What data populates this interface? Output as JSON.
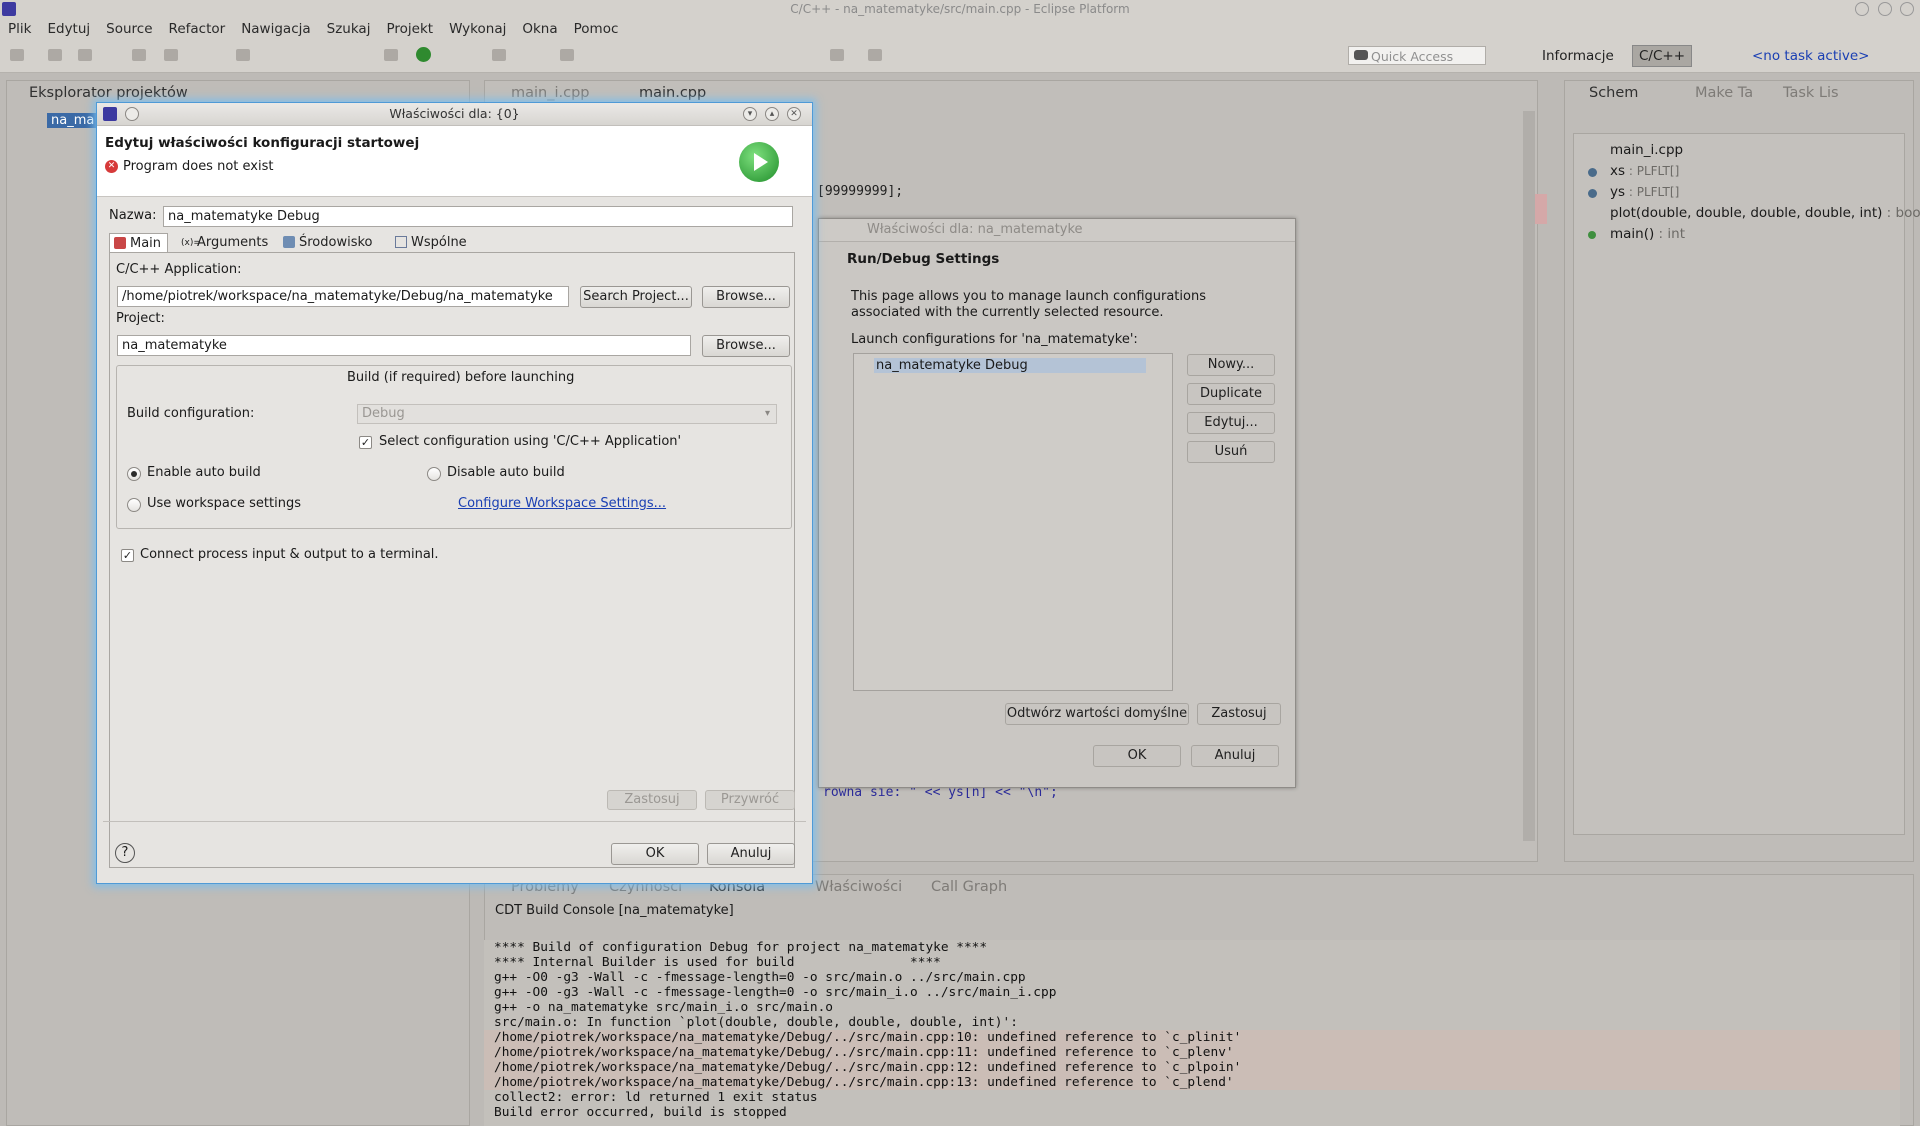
{
  "window": {
    "title": "C/C++ - na_matematyke/src/main.cpp - Eclipse Platform"
  },
  "menu": [
    "Plik",
    "Edytuj",
    "Source",
    "Refactor",
    "Nawigacja",
    "Szukaj",
    "Projekt",
    "Wykonaj",
    "Okna",
    "Pomoc"
  ],
  "toolbar": {
    "quick_access_placeholder": "Quick Access",
    "perspective_info": "Informacje",
    "perspective_cpp": "C/C++",
    "task": "<no task active>"
  },
  "left_pane": {
    "tab": "Eksplorator projektów",
    "item": "na_ma"
  },
  "editor": {
    "tabs": [
      "main_i.cpp",
      "main.cpp"
    ],
    "lines": [
      {
        "text": "[99999999];"
      },
      {
        "text": "rowna sie: \" << ys[n] << \"\\n\";"
      }
    ]
  },
  "outline": {
    "tabs": [
      "Schem",
      "Make Ta",
      "Task Lis"
    ],
    "items": [
      {
        "name": "main_i.cpp",
        "type": ""
      },
      {
        "name": "xs",
        "type": " : PLFLT[]"
      },
      {
        "name": "ys",
        "type": " : PLFLT[]"
      },
      {
        "name": "plot(double, double, double, double, int)",
        "type": " : bool"
      },
      {
        "name": "main()",
        "type": " : int"
      }
    ]
  },
  "bottom": {
    "tabs": [
      "Problemy",
      "Czynności",
      "Konsola",
      "Właściwości",
      "Call Graph"
    ],
    "console_title": "CDT Build Console [na_matematyke]",
    "lines": [
      {
        "text": "",
        "err": false
      },
      {
        "text": "**** Build of configuration Debug for project na_matematyke ****",
        "err": false
      },
      {
        "text": "",
        "err": false
      },
      {
        "text": "**** Internal Builder is used for build               ****",
        "err": false
      },
      {
        "text": "g++ -O0 -g3 -Wall -c -fmessage-length=0 -o src/main.o ../src/main.cpp",
        "err": false
      },
      {
        "text": "g++ -O0 -g3 -Wall -c -fmessage-length=0 -o src/main_i.o ../src/main_i.cpp",
        "err": false
      },
      {
        "text": "g++ -o na_matematyke src/main_i.o src/main.o",
        "err": false
      },
      {
        "text": "src/main.o: In function `plot(double, double, double, double, int)':",
        "err": false
      },
      {
        "text": "/home/piotrek/workspace/na_matematyke/Debug/../src/main.cpp:10: undefined reference to `c_plinit'",
        "err": true
      },
      {
        "text": "/home/piotrek/workspace/na_matematyke/Debug/../src/main.cpp:11: undefined reference to `c_plenv'",
        "err": true
      },
      {
        "text": "/home/piotrek/workspace/na_matematyke/Debug/../src/main.cpp:12: undefined reference to `c_plpoin'",
        "err": true
      },
      {
        "text": "/home/piotrek/workspace/na_matematyke/Debug/../src/main.cpp:13: undefined reference to `c_plend'",
        "err": true
      },
      {
        "text": "collect2: error: ld returned 1 exit status",
        "err": false
      },
      {
        "text": "Build error occurred, build is stopped",
        "err": false
      }
    ]
  },
  "dialog2": {
    "title": "Właściwości dla: na_matematyke",
    "heading": "Run/Debug Settings",
    "description": "This page allows you to manage launch configurations associated with the currently selected resource.",
    "list_label": "Launch configurations for 'na_matematyke':",
    "items": [
      "na_matematyke Debug"
    ],
    "buttons": {
      "new": "Nowy...",
      "duplicate": "Duplicate",
      "edit": "Edytuj...",
      "remove": "Usuń",
      "restore": "Odtwórz wartości domyślne",
      "apply": "Zastosuj",
      "ok": "OK",
      "cancel": "Anuluj"
    }
  },
  "dialog": {
    "title": "Właściwości dla: {0}",
    "heading": "Edytuj właściwości konfiguracji startowej",
    "error": "Program does not exist",
    "name_label": "Nazwa:",
    "name_value": "na_matematyke Debug",
    "tabs": [
      "Main",
      "Arguments",
      "Środowisko",
      "Wspólne"
    ],
    "app_label": "C/C++ Application:",
    "app_value": "/home/piotrek/workspace/na_matematyke/Debug/na_matematyke",
    "search_project": "Search Project...",
    "browse": "Browse...",
    "project_label": "Project:",
    "project_value": "na_matematyke",
    "build_group": "Build (if required) before launching",
    "build_config_label": "Build configuration:",
    "build_config_value": "Debug",
    "select_config": "Select configuration using 'C/C++ Application'",
    "enable_auto": "Enable auto build",
    "disable_auto": "Disable auto build",
    "use_workspace": "Use workspace settings",
    "configure_link": "Configure Workspace Settings...",
    "connect_terminal": "Connect process input & output to a terminal.",
    "apply": "Zastosuj",
    "revert": "Przywróć",
    "ok": "OK",
    "cancel": "Anuluj",
    "help": "?"
  }
}
